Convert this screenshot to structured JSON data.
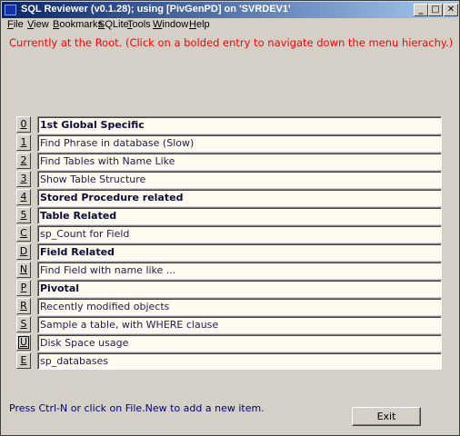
{
  "window": {
    "title": "SQL Reviewer (v0.1.28); using [PivGenPD] on 'SVRDEV1'",
    "minimize_glyph": "_",
    "maximize_glyph": "□",
    "close_glyph": "✕"
  },
  "menu": [
    "File",
    "View",
    "Bookmarks",
    "SQLite",
    "Tools",
    "Window",
    "Help"
  ],
  "status": "Currently at the Root. (Click on a bolded entry to navigate down the menu hierachy.)",
  "items": [
    {
      "key": "0",
      "label": "1st Global Specific",
      "bold": true
    },
    {
      "key": "1",
      "label": "Find Phrase in database (Slow)",
      "bold": false
    },
    {
      "key": "2",
      "label": "Find Tables with Name Like",
      "bold": false
    },
    {
      "key": "3",
      "label": "Show Table Structure",
      "bold": false
    },
    {
      "key": "4",
      "label": "Stored Procedure related",
      "bold": true
    },
    {
      "key": "5",
      "label": "Table Related",
      "bold": true
    },
    {
      "key": "C",
      "label": "sp_Count for Field",
      "bold": false
    },
    {
      "key": "D",
      "label": "Field Related",
      "bold": true
    },
    {
      "key": "N",
      "label": "Find Field with name like ...",
      "bold": false
    },
    {
      "key": "P",
      "label": "Pivotal",
      "bold": true
    },
    {
      "key": "R",
      "label": "Recently modified objects",
      "bold": false
    },
    {
      "key": "S",
      "label": "Sample a table, with WHERE clause",
      "bold": false
    },
    {
      "key": "U",
      "label": "Disk Space usage",
      "bold": false
    },
    {
      "key": "E",
      "label": "sp_databases",
      "bold": false
    }
  ],
  "hint": "Press Ctrl-N or click on File.New to add a new item.",
  "exit_label": "Exit"
}
